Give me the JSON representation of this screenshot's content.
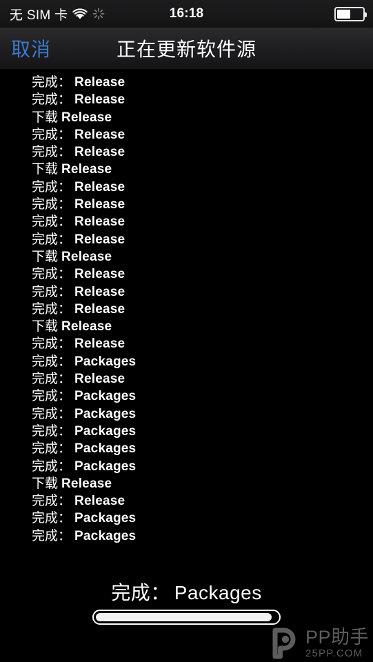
{
  "status_bar": {
    "carrier": "无 SIM 卡",
    "wifi_icon": "wifi-icon",
    "sync_icon": "sync-activity-icon",
    "time": "16:18",
    "battery_icon": "battery-icon",
    "battery_percent": 52
  },
  "nav_bar": {
    "cancel_label": "取消",
    "title": "正在更新软件源",
    "cancel_color": "#3c7ad1"
  },
  "log": {
    "label_done": "完成",
    "label_download": "下载",
    "lines": [
      {
        "label": "完成",
        "colon": true,
        "value": "Release"
      },
      {
        "label": "完成",
        "colon": true,
        "value": "Release"
      },
      {
        "label": "下载",
        "colon": false,
        "value": "Release"
      },
      {
        "label": "完成",
        "colon": true,
        "value": "Release"
      },
      {
        "label": "完成",
        "colon": true,
        "value": "Release"
      },
      {
        "label": "下载",
        "colon": false,
        "value": "Release"
      },
      {
        "label": "完成",
        "colon": true,
        "value": "Release"
      },
      {
        "label": "完成",
        "colon": true,
        "value": "Release"
      },
      {
        "label": "完成",
        "colon": true,
        "value": "Release"
      },
      {
        "label": "完成",
        "colon": true,
        "value": "Release"
      },
      {
        "label": "下载",
        "colon": false,
        "value": "Release"
      },
      {
        "label": "完成",
        "colon": true,
        "value": "Release"
      },
      {
        "label": "完成",
        "colon": true,
        "value": "Release"
      },
      {
        "label": "完成",
        "colon": true,
        "value": "Release"
      },
      {
        "label": "下载",
        "colon": false,
        "value": "Release"
      },
      {
        "label": "完成",
        "colon": true,
        "value": "Release"
      },
      {
        "label": "完成",
        "colon": true,
        "value": "Packages"
      },
      {
        "label": "完成",
        "colon": true,
        "value": "Release"
      },
      {
        "label": "完成",
        "colon": true,
        "value": "Packages"
      },
      {
        "label": "完成",
        "colon": true,
        "value": "Packages"
      },
      {
        "label": "完成",
        "colon": true,
        "value": "Packages"
      },
      {
        "label": "完成",
        "colon": true,
        "value": "Packages"
      },
      {
        "label": "完成",
        "colon": true,
        "value": "Packages"
      },
      {
        "label": "下载",
        "colon": false,
        "value": "Release"
      },
      {
        "label": "完成",
        "colon": true,
        "value": "Release"
      },
      {
        "label": "完成",
        "colon": true,
        "value": "Packages"
      },
      {
        "label": "完成",
        "colon": true,
        "value": "Packages"
      }
    ]
  },
  "footer": {
    "status_label": "完成：",
    "status_value": "Packages",
    "progress_percent": 97
  },
  "watermark": {
    "logo_icon": "pp-logo-icon",
    "title": "PP助手",
    "subtitle": "25PP.COM",
    "color": "#a8a8a8"
  }
}
